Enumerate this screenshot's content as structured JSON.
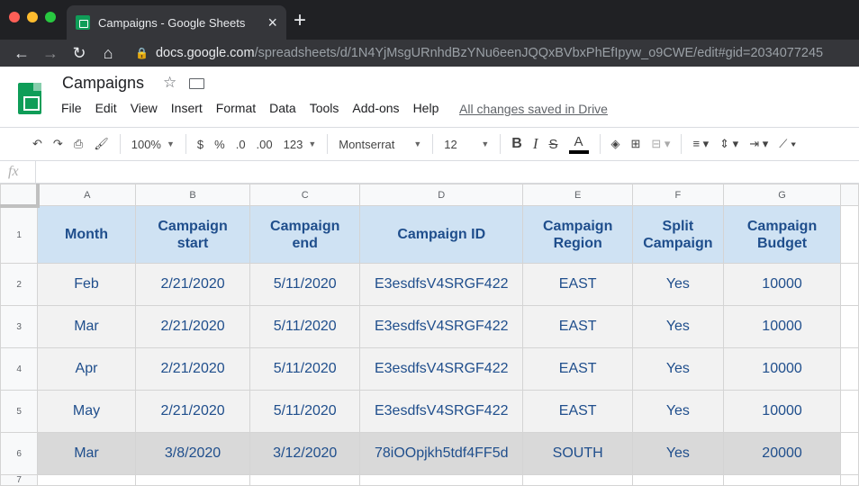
{
  "browser": {
    "tab_title": "Campaigns - Google Sheets",
    "url_host": "docs.google.com",
    "url_path": "/spreadsheets/d/1N4YjMsgURnhdBzYNu6eenJQQxBVbxPhEfIpyw_o9CWE/edit#gid=2034077245",
    "traffic_colors": [
      "#ff5f57",
      "#febc2e",
      "#28c840"
    ]
  },
  "doc": {
    "title": "Campaigns",
    "menus": [
      "File",
      "Edit",
      "View",
      "Insert",
      "Format",
      "Data",
      "Tools",
      "Add-ons",
      "Help"
    ],
    "save_status": "All changes saved in Drive"
  },
  "toolbar": {
    "zoom": "100%",
    "currency": "$",
    "percent": "%",
    "dec_decrease": ".0",
    "dec_increase": ".00",
    "more_formats": "123",
    "font": "Montserrat",
    "font_size": "12",
    "bold": "B",
    "italic": "I",
    "strike": "S",
    "text_color": "A"
  },
  "formula_bar": {
    "fx": "fx",
    "value": ""
  },
  "sheet": {
    "columns": [
      "A",
      "B",
      "C",
      "D",
      "E",
      "F",
      "G"
    ],
    "headers": [
      "Month",
      "Campaign start",
      "Campaign end",
      "Campaign ID",
      "Campaign Region",
      "Split Campaign",
      "Campaign Budget"
    ],
    "rows": [
      {
        "num": "2",
        "cells": [
          "Feb",
          "2/21/2020",
          "5/11/2020",
          "E3esdfsV4SRGF422",
          "EAST",
          "Yes",
          "10000"
        ]
      },
      {
        "num": "3",
        "cells": [
          "Mar",
          "2/21/2020",
          "5/11/2020",
          "E3esdfsV4SRGF422",
          "EAST",
          "Yes",
          "10000"
        ]
      },
      {
        "num": "4",
        "cells": [
          "Apr",
          "2/21/2020",
          "5/11/2020",
          "E3esdfsV4SRGF422",
          "EAST",
          "Yes",
          "10000"
        ]
      },
      {
        "num": "5",
        "cells": [
          "May",
          "2/21/2020",
          "5/11/2020",
          "E3esdfsV4SRGF422",
          "EAST",
          "Yes",
          "10000"
        ]
      },
      {
        "num": "6",
        "cells": [
          "Mar",
          "3/8/2020",
          "3/12/2020",
          "78iOOpjkh5tdf4FF5d",
          "SOUTH",
          "Yes",
          "20000"
        ]
      }
    ],
    "header_row_num": "1",
    "partial_row_num": "7"
  }
}
